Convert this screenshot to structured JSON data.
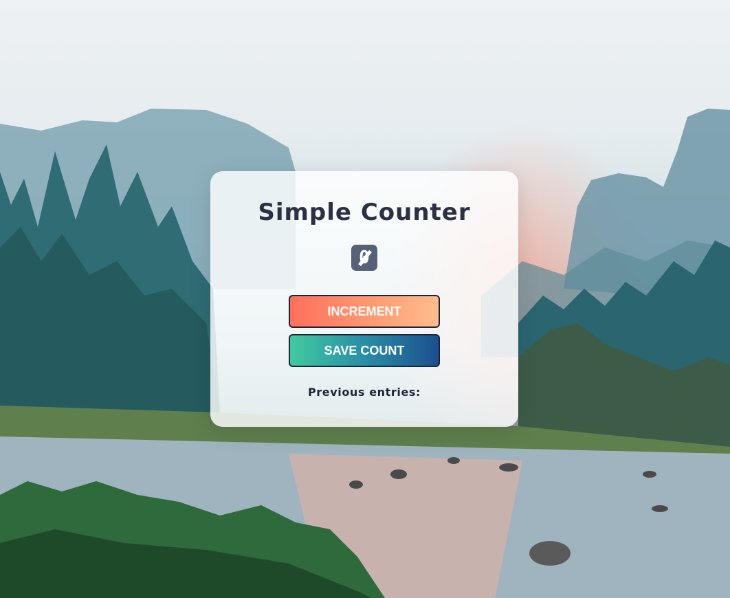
{
  "app": {
    "title": "Simple Counter",
    "count": "0",
    "increment_label": "INCREMENT",
    "save_label": "SAVE COUNT",
    "previous_entries_label": "Previous entries:"
  },
  "colors": {
    "title_text": "#2b3142",
    "counter_badge": "#566178",
    "increment_gradient_start": "#ff6f5c",
    "increment_gradient_end": "#ffbc8e",
    "save_gradient_start": "#41c9a0",
    "save_gradient_end": "#1c4f8f",
    "button_border": "#1e2436"
  },
  "background": {
    "description_icon": "landscape-photo"
  }
}
